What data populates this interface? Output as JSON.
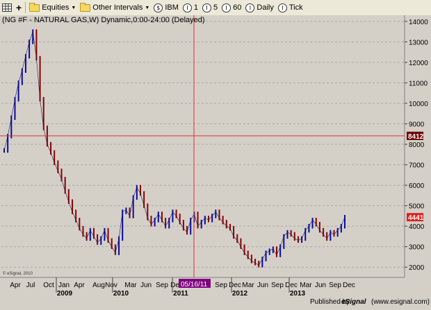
{
  "toolbar": {
    "grid_icon": "grid-icon",
    "add_icon": "+",
    "equities": "Equities",
    "other_intervals": "Other Intervals",
    "symbol_ibm": "IBM",
    "interval_1": "1",
    "interval_5": "5",
    "interval_60": "60",
    "interval_daily": "Daily",
    "interval_tick": "Tick",
    "dollar_glyph": "$",
    "interval_glyph": "I",
    "caret": "▼"
  },
  "chart": {
    "title": "(NG #F - NATURAL GAS,W) Dynamic,0:00-24:00 (Delayed)",
    "copyright": "© eSignal, 2010",
    "published_by": "Published by",
    "esignal_logo": "eSignal",
    "website": "(www.esignal.com)",
    "crosshair_date": "05/16/11",
    "crosshair_price": "8412",
    "last_price": "4441",
    "colors": {
      "bg": "#d4d0c8",
      "up_bar": "#0a0aa0",
      "down_bar": "#8b0000",
      "crosshair": "#e03030",
      "last_price_box": "#e02020",
      "cursor_price_box": "#6e0000",
      "date_box": "#800080"
    }
  },
  "chart_data": {
    "type": "line",
    "title": "(NG #F - NATURAL GAS,W) Dynamic,0:00-24:00 (Delayed)",
    "ylim": [
      1500,
      14300
    ],
    "yticks": [
      2000,
      3000,
      4000,
      5000,
      6000,
      7000,
      8000,
      9000,
      10000,
      11000,
      12000,
      13000,
      14000
    ],
    "month_labels": [
      "Apr",
      "Jul",
      "Oct",
      "Jan",
      "Apr",
      "Aug",
      "Nov",
      "Mar",
      "Jun",
      "Sep",
      "Dec",
      "Sep",
      "Dec",
      "Mar",
      "Jun",
      "Sep",
      "Dec",
      "Mar",
      "Jun",
      "Sep",
      "Dec"
    ],
    "year_labels": [
      "2009",
      "2010",
      "2011",
      "2012",
      "2013"
    ],
    "series": [
      {
        "values": [
          7700,
          8400,
          9300,
          10200,
          11000,
          11600,
          12300,
          13000,
          13500,
          12200,
          10200,
          8800,
          8000,
          7600,
          7100,
          6700,
          6300,
          5700,
          5200,
          4700,
          4300,
          3900,
          3600,
          3400,
          3800,
          3500,
          3200,
          3400,
          3800,
          3300,
          3000,
          2700,
          3400,
          4700,
          4800,
          4500,
          5400,
          5900,
          5600,
          5000,
          4400,
          4100,
          4300,
          4600,
          4300,
          4000,
          4300,
          4700,
          4500,
          4200,
          3900,
          3700,
          4300,
          4600,
          4000,
          4200,
          4400,
          4300,
          4500,
          4700,
          4400,
          4200,
          4000,
          3900,
          3500,
          3300,
          3000,
          2700,
          2500,
          2300,
          2200,
          2100,
          2400,
          2700,
          2800,
          2900,
          2600,
          3000,
          3500,
          3700,
          3600,
          3400,
          3300,
          3400,
          3800,
          4000,
          4300,
          4100,
          3800,
          3600,
          3400,
          3700,
          3600,
          3800,
          4000,
          4441
        ]
      }
    ]
  }
}
